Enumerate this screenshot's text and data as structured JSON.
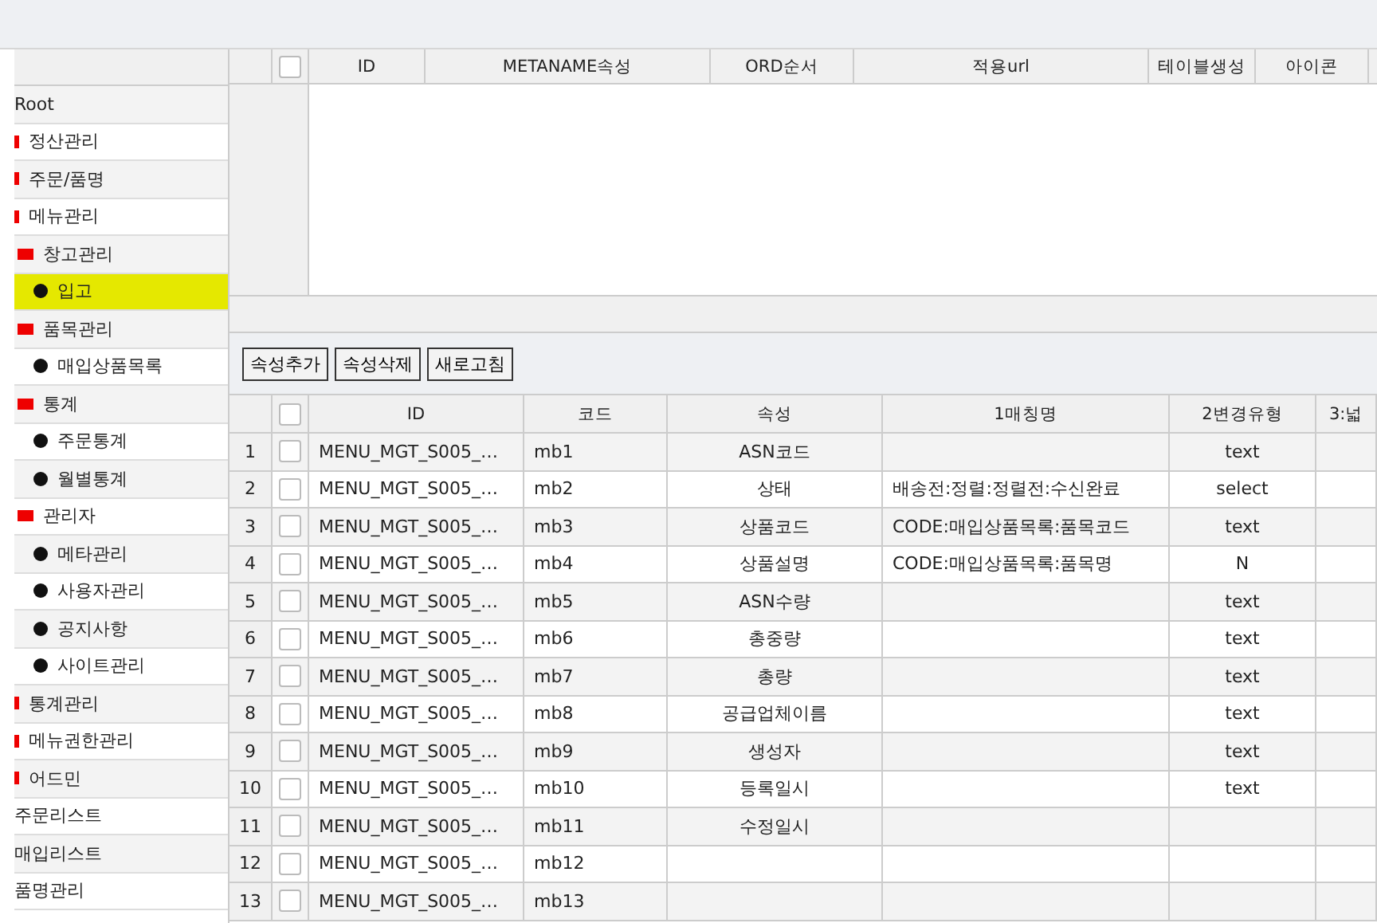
{
  "tree": {
    "items": [
      {
        "label": "Root",
        "selected": false,
        "children": [
          {
            "label": "정산관리",
            "kind": "folder",
            "selected": false
          },
          {
            "label": "주문/품명",
            "kind": "folder",
            "selected": false
          },
          {
            "label": "메뉴관리",
            "kind": "folder",
            "selected": false,
            "children": [
              {
                "label": "창고관리",
                "kind": "folder",
                "selected": false,
                "children": [
                  {
                    "label": "입고",
                    "kind": "leaf",
                    "selected": true
                  }
                ]
              },
              {
                "label": "품목관리",
                "kind": "folder",
                "selected": false,
                "children": [
                  {
                    "label": "매입상품목록",
                    "kind": "leaf",
                    "selected": false
                  }
                ]
              },
              {
                "label": "통계",
                "kind": "folder",
                "selected": false,
                "children": [
                  {
                    "label": "주문통계",
                    "kind": "leaf",
                    "selected": false
                  },
                  {
                    "label": "월별통계",
                    "kind": "leaf",
                    "selected": false
                  }
                ]
              },
              {
                "label": "관리자",
                "kind": "folder",
                "selected": false,
                "children": [
                  {
                    "label": "메타관리",
                    "kind": "leaf",
                    "selected": false
                  },
                  {
                    "label": "사용자관리",
                    "kind": "leaf",
                    "selected": false
                  },
                  {
                    "label": "공지사항",
                    "kind": "leaf",
                    "selected": false
                  },
                  {
                    "label": "사이트관리",
                    "kind": "leaf",
                    "selected": false
                  }
                ]
              }
            ]
          },
          {
            "label": "통계관리",
            "kind": "folder",
            "selected": false
          },
          {
            "label": "메뉴권한관리",
            "kind": "folder",
            "selected": false
          },
          {
            "label": "어드민",
            "kind": "folder",
            "selected": false
          }
        ]
      },
      {
        "label": "주문리스트",
        "selected": false
      },
      {
        "label": "매입리스트",
        "selected": false
      },
      {
        "label": "품명관리",
        "selected": false
      }
    ]
  },
  "meta_table": {
    "all_checked": false,
    "columns": [
      "ID",
      "METANAME속성",
      "ORD순서",
      "적용url",
      "테이블생성",
      "아이콘"
    ]
  },
  "buttons": [
    "속성추가",
    "속성삭제",
    "새로고침"
  ],
  "attr_table": {
    "all_checked": false,
    "columns": [
      "ID",
      "코드",
      "속성",
      "1매칭명",
      "2변경유형",
      "3:넓"
    ],
    "rows": [
      {
        "no": "1",
        "checked": false,
        "cells": [
          "MENU_MGT_S005_…",
          "mb1",
          "ASN코드",
          "",
          "text",
          ""
        ]
      },
      {
        "no": "2",
        "checked": false,
        "cells": [
          "MENU_MGT_S005_…",
          "mb2",
          "상태",
          "배송전:정렬:정렬전:수신완료",
          "select",
          ""
        ]
      },
      {
        "no": "3",
        "checked": false,
        "cells": [
          "MENU_MGT_S005_…",
          "mb3",
          "상품코드",
          "CODE:매입상품목록:품목코드",
          "text",
          ""
        ]
      },
      {
        "no": "4",
        "checked": false,
        "cells": [
          "MENU_MGT_S005_…",
          "mb4",
          "상품설명",
          "CODE:매입상품목록:품목명",
          "N",
          ""
        ]
      },
      {
        "no": "5",
        "checked": false,
        "cells": [
          "MENU_MGT_S005_…",
          "mb5",
          "ASN수량",
          "",
          "text",
          ""
        ]
      },
      {
        "no": "6",
        "checked": false,
        "cells": [
          "MENU_MGT_S005_…",
          "mb6",
          "총중량",
          "",
          "text",
          ""
        ]
      },
      {
        "no": "7",
        "checked": false,
        "cells": [
          "MENU_MGT_S005_…",
          "mb7",
          "총량",
          "",
          "text",
          ""
        ]
      },
      {
        "no": "8",
        "checked": false,
        "cells": [
          "MENU_MGT_S005_…",
          "mb8",
          "공급업체이름",
          "",
          "text",
          ""
        ]
      },
      {
        "no": "9",
        "checked": false,
        "cells": [
          "MENU_MGT_S005_…",
          "mb9",
          "생성자",
          "",
          "text",
          ""
        ]
      },
      {
        "no": "10",
        "checked": false,
        "cells": [
          "MENU_MGT_S005_…",
          "mb10",
          "등록일시",
          "",
          "text",
          ""
        ]
      },
      {
        "no": "11",
        "checked": false,
        "cells": [
          "MENU_MGT_S005_…",
          "mb11",
          "수정일시",
          "",
          "",
          ""
        ]
      },
      {
        "no": "12",
        "checked": false,
        "cells": [
          "MENU_MGT_S005_…",
          "mb12",
          "",
          "",
          "",
          ""
        ]
      },
      {
        "no": "13",
        "checked": false,
        "cells": [
          "MENU_MGT_S005_…",
          "mb13",
          "",
          "",
          "",
          ""
        ]
      }
    ]
  }
}
